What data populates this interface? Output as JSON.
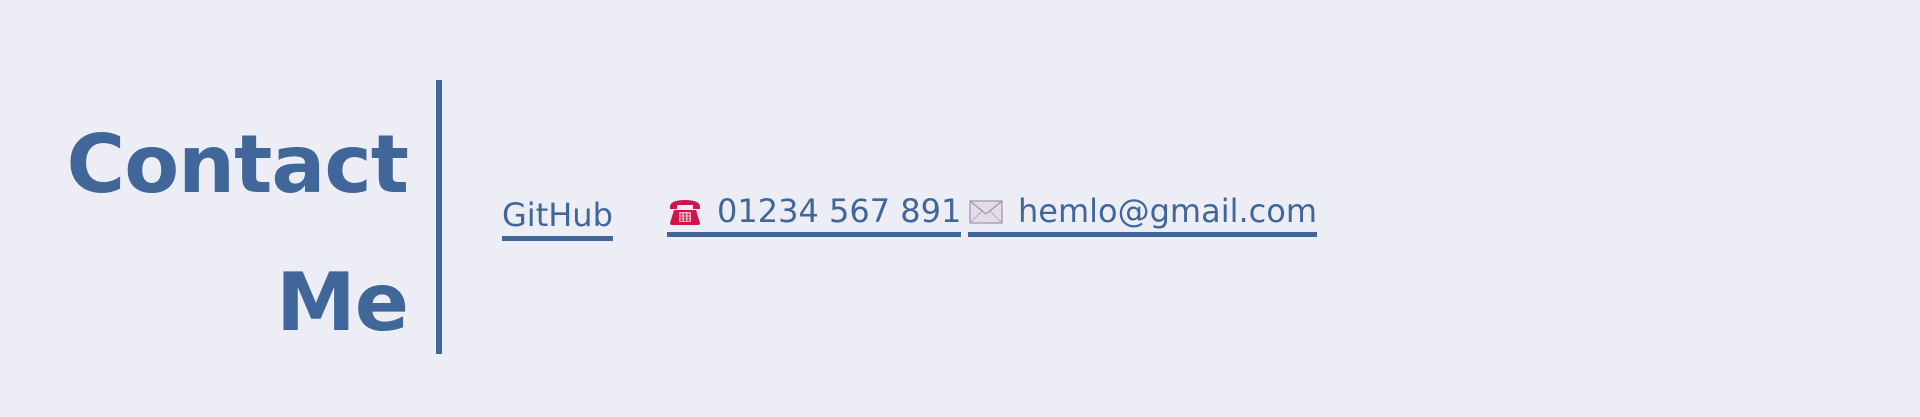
{
  "contact": {
    "heading_line1": "Contact",
    "heading_line2": "Me",
    "links": {
      "github": {
        "label": "GitHub"
      },
      "phone": {
        "label": "01234 567 891",
        "icon": "telephone-icon"
      },
      "email": {
        "label": "hemlo@gmail.com",
        "icon": "envelope-icon"
      }
    },
    "colors": {
      "background": "#ecedf5",
      "accent": "#41679a",
      "phone_icon": "#d0154e"
    }
  }
}
